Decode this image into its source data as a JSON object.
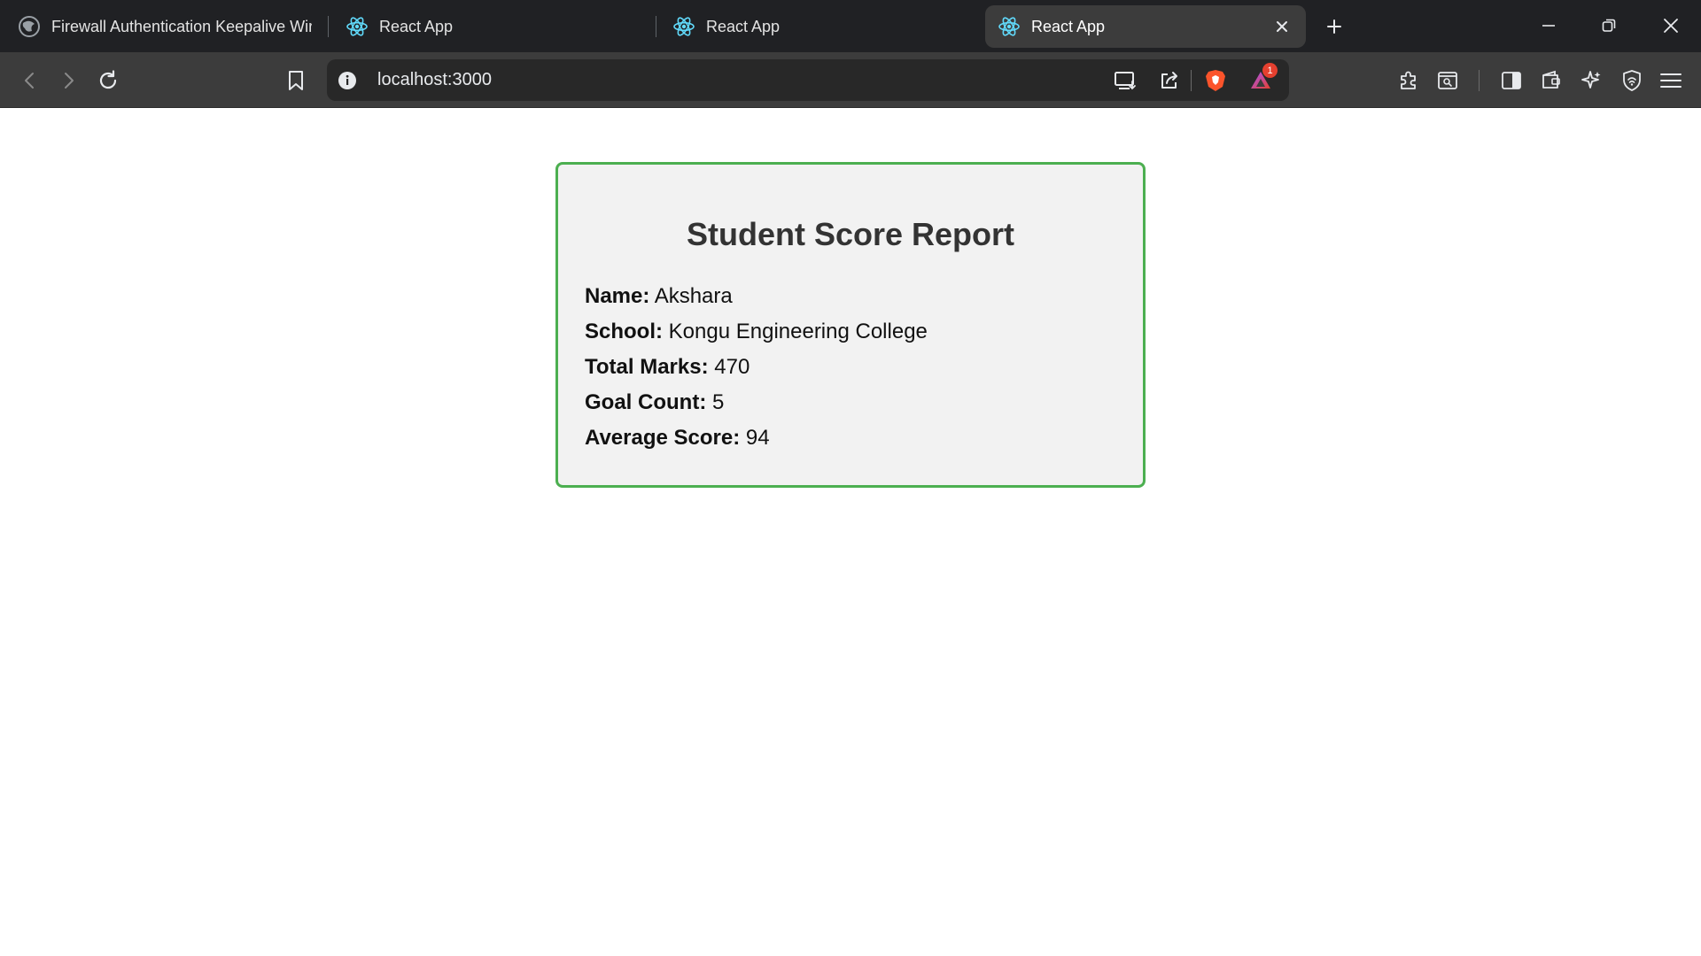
{
  "browser": {
    "tabs": [
      {
        "title": "Firewall Authentication Keepalive Wir",
        "favicon": "globe-icon",
        "active": false
      },
      {
        "title": "React App",
        "favicon": "react-icon",
        "active": false
      },
      {
        "title": "React App",
        "favicon": "react-icon",
        "active": false
      },
      {
        "title": "React App",
        "favicon": "react-icon",
        "active": true
      }
    ],
    "url": "localhost:3000",
    "notification_count": "1"
  },
  "report": {
    "title": "Student Score Report",
    "fields": [
      {
        "label": "Name:",
        "value": "Akshara"
      },
      {
        "label": "School:",
        "value": "Kongu Engineering College"
      },
      {
        "label": "Total Marks:",
        "value": "470"
      },
      {
        "label": "Goal Count:",
        "value": "5"
      },
      {
        "label": "Average Score:",
        "value": "94"
      }
    ]
  },
  "colors": {
    "card_border": "#4caf50",
    "card_background": "#f2f2f2",
    "title_text": "#333333"
  }
}
